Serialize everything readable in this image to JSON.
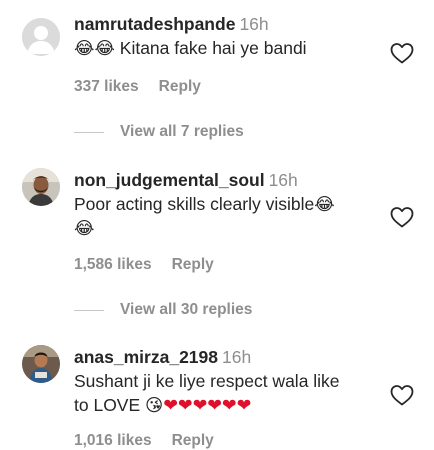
{
  "comments": [
    {
      "username": "namrutadeshpande",
      "time": "16h",
      "emoji_prefix": "😂😂",
      "text": " Kitana fake hai ye bandi",
      "text_line2": "",
      "likes": "337 likes",
      "reply": "Reply",
      "view_replies": "View all 7 replies",
      "avatar": "default-user-avatar"
    },
    {
      "username": "non_judgemental_soul",
      "time": "16h",
      "text": "Poor acting skills clearly visible",
      "emoji_suffix": "😂",
      "text_line2": "😂",
      "likes": "1,586 likes",
      "reply": "Reply",
      "view_replies": "View all 30 replies",
      "avatar": "profile-photo"
    },
    {
      "username": "anas_mirza_2198",
      "time": "16h",
      "text": "Sushant ji ke liye respect wala like",
      "text_line2": "to LOVE ",
      "emoji_kiss": "😘",
      "hearts": "❤❤❤❤❤❤",
      "likes": "1,016 likes",
      "reply": "Reply",
      "avatar": "profile-photo"
    }
  ],
  "colors": {
    "text": "#262626",
    "muted": "#8e8e8e",
    "heart": "#e0102a",
    "divider": "#c7c7c7"
  },
  "icons": {
    "like": "heart-outline-icon"
  }
}
